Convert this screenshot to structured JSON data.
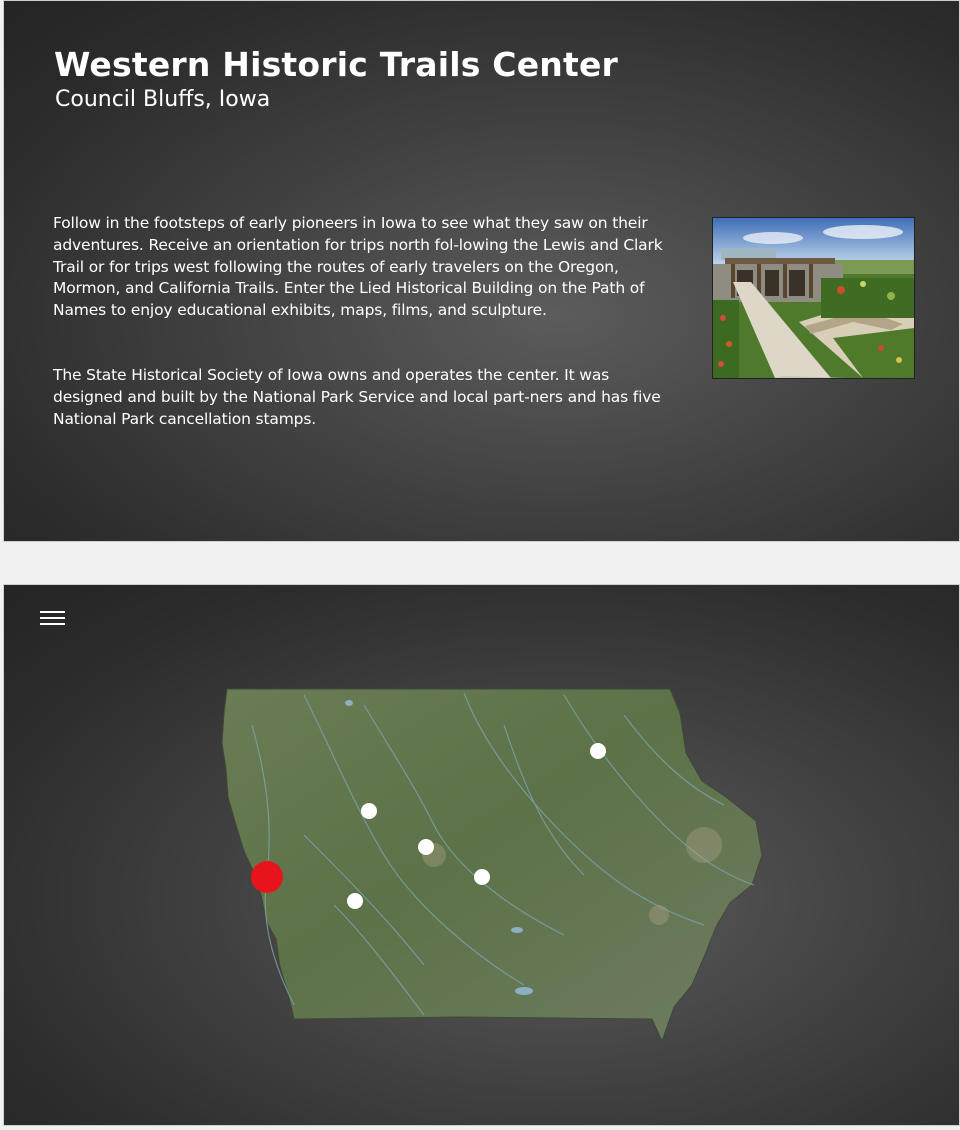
{
  "site": {
    "title": "Western Historic Trails Center",
    "location": "Council Bluffs, Iowa",
    "paragraphs": [
      "Follow in the footsteps of early pioneers in Iowa to see what they saw on their adventures. Receive an orientation for trips north fol-lowing the Lewis and Clark Trail or for trips west following the routes of early travelers on the Oregon, Mormon, and California Trails. Enter the Lied Historical Building on the Path of Names to enjoy educational exhibits, maps, films, and sculpture.",
      "The State Historical Society of Iowa owns and operates the center. It was designed and built by the National Park Service and local part-ners and has five National Park cancellation stamps."
    ]
  },
  "map": {
    "region_icon": "iowa-state-map",
    "menu_icon": "hamburger-menu-icon",
    "marker_colors": {
      "selected": "#e8141c",
      "other": "#ffffff"
    }
  }
}
